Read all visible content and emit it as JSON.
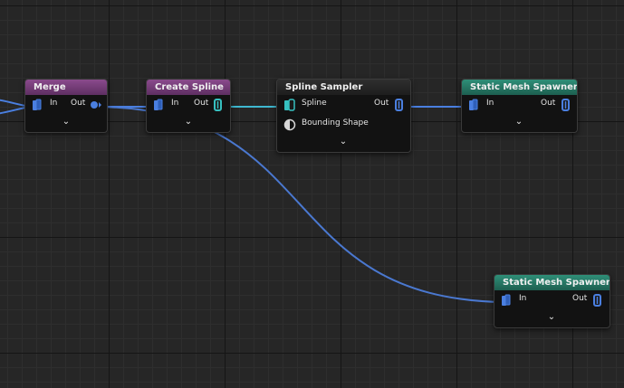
{
  "graph": {
    "nodes": {
      "merge": {
        "title": "Merge",
        "pins": {
          "in": "In",
          "out": "Out"
        }
      },
      "create_spline": {
        "title": "Create Spline",
        "pins": {
          "in": "In",
          "out": "Out"
        }
      },
      "spline_sampler": {
        "title": "Spline Sampler",
        "pins": {
          "spline": "Spline",
          "bounding_shape": "Bounding Shape",
          "out": "Out"
        }
      },
      "static_mesh_spawner_1": {
        "title": "Static Mesh Spawner",
        "pins": {
          "in": "In",
          "out": "Out"
        }
      },
      "static_mesh_spawner_2": {
        "title": "Static Mesh Spawner",
        "pins": {
          "in": "In",
          "out": "Out"
        }
      }
    }
  },
  "colors": {
    "wire_teal": "#3fb8d0",
    "wire_blue": "#4a78d0",
    "pin_blue": "#4a7fe0",
    "pin_teal": "#36c0c0",
    "header_purple": "#7a3f7e",
    "header_teal": "#2a7a66",
    "header_gray": "#2a2a2a"
  },
  "icons": {
    "point_pin": "stacked-points-icon",
    "spline_pin": "spline-icon",
    "shape_pin": "bounding-shape-icon",
    "expand": "chevron-down-icon"
  }
}
